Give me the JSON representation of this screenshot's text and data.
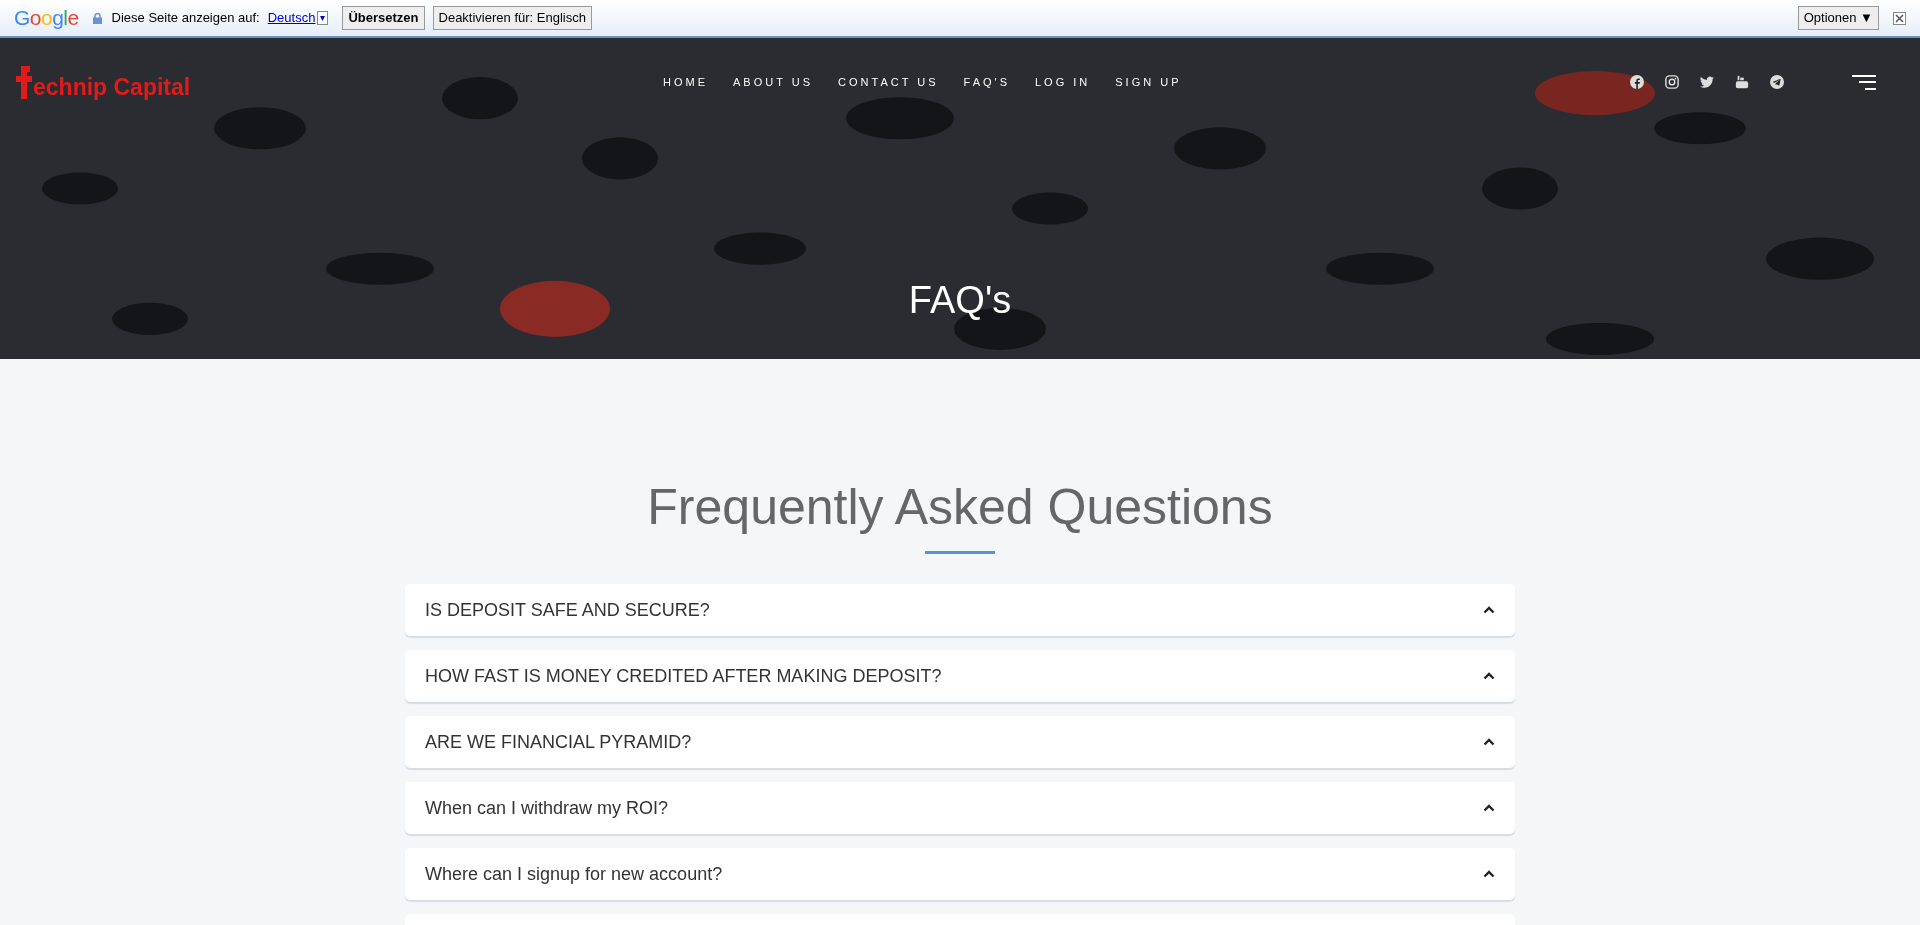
{
  "translate_bar": {
    "google_logo": [
      {
        "letter": "G",
        "color": "#4285f4"
      },
      {
        "letter": "o",
        "color": "#ea4335"
      },
      {
        "letter": "o",
        "color": "#fbbc05"
      },
      {
        "letter": "g",
        "color": "#4285f4"
      },
      {
        "letter": "l",
        "color": "#34a853"
      },
      {
        "letter": "e",
        "color": "#ea4335"
      }
    ],
    "prompt": "Diese Seite anzeigen auf:",
    "language_link": "Deutsch",
    "language_caret": "▾",
    "translate_button": "Übersetzen",
    "disable_button": "Deaktivieren für: Englisch",
    "options_button": "Optionen ▼"
  },
  "header": {
    "logo_text": "echnip Capital",
    "nav": [
      {
        "label": "HOME"
      },
      {
        "label": "ABOUT US"
      },
      {
        "label": "CONTACT US"
      },
      {
        "label": "FAQ'S"
      },
      {
        "label": "LOG IN"
      },
      {
        "label": "SIGN UP"
      }
    ],
    "social": [
      {
        "kind": "facebook"
      },
      {
        "kind": "instagram"
      },
      {
        "kind": "twitter"
      },
      {
        "kind": "youtube"
      },
      {
        "kind": "telegram"
      }
    ],
    "hero_title": "FAQ's"
  },
  "section": {
    "title": "Frequently Asked Questions",
    "questions": [
      {
        "question": "IS DEPOSIT SAFE AND SECURE?"
      },
      {
        "question": "HOW FAST IS MONEY CREDITED AFTER MAKING DEPOSIT?"
      },
      {
        "question": "ARE WE FINANCIAL PYRAMID?"
      },
      {
        "question": "When can I withdraw my ROI?"
      },
      {
        "question": "Where can I signup for new account?"
      }
    ]
  }
}
